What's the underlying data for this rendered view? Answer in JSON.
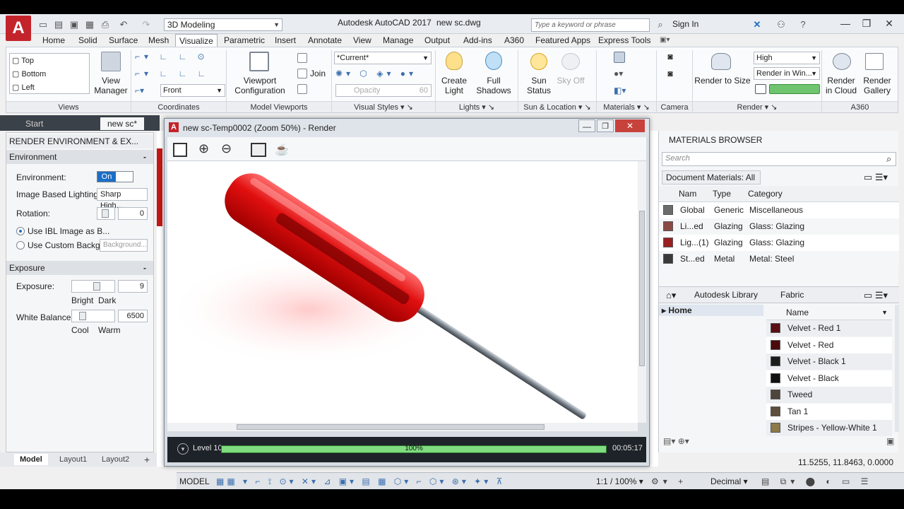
{
  "title": {
    "app_name": "Autodesk AutoCAD 2017",
    "file_name": "new sc.dwg",
    "workspace": "3D Modeling",
    "search_placeholder": "Type a keyword or phrase",
    "sign_in": "Sign In",
    "logo_letter": "A"
  },
  "ribbon_tabs": [
    "Home",
    "Solid",
    "Surface",
    "Mesh",
    "Visualize",
    "Parametric",
    "Insert",
    "Annotate",
    "View",
    "Manage",
    "Output",
    "Add-ins",
    "A360",
    "Featured Apps",
    "Express Tools"
  ],
  "ribbon": {
    "views": {
      "items": [
        "Top",
        "Bottom",
        "Left"
      ],
      "view_manager": "View Manager",
      "title": "Views"
    },
    "coordinates": {
      "front": "Front",
      "title": "Coordinates"
    },
    "model_viewports": {
      "viewport_config": "Viewport Configuration",
      "join": "Join",
      "title": "Model Viewports"
    },
    "visual_styles": {
      "current": "*Current*",
      "opacity": "Opacity",
      "opacity_value": "60",
      "title": "Visual Styles"
    },
    "lights": {
      "create_light": "Create Light",
      "full_shadows": "Full Shadows",
      "title": "Lights"
    },
    "sun_location": {
      "sun_status": "Sun Status",
      "sky_off": "Sky Off",
      "title": "Sun & Location"
    },
    "materials": {
      "title": "Materials"
    },
    "camera": {
      "title": "Camera"
    },
    "render": {
      "quality": "High",
      "render_in": "Render in Win...",
      "render_to_size": "Render to Size",
      "title": "Render"
    },
    "a360": {
      "render_cloud": "Render in Cloud",
      "render_gallery": "Render Gallery",
      "title": "A360"
    }
  },
  "file_tabs": [
    "Start",
    "new sc*"
  ],
  "render_env": {
    "header": "RENDER ENVIRONMENT & EX...",
    "environment_section": "Environment",
    "environment_label": "Environment:",
    "environment_value": "On",
    "ibl_label": "Image Based Lighting:",
    "ibl_value": "Sharp High...",
    "rotation_label": "Rotation:",
    "rotation_value": "0",
    "use_ibl": "Use IBL Image as B...",
    "use_custom": "Use Custom Backg...",
    "background_btn": "Background...",
    "exposure_section": "Exposure",
    "exposure_label": "Exposure:",
    "exposure_value": "9",
    "bright": "Bright",
    "dark": "Dark",
    "white_balance_label": "White Balance:",
    "white_balance_value": "6500",
    "cool": "Cool",
    "warm": "Warm"
  },
  "layout_tabs": [
    "Model",
    "Layout1",
    "Layout2"
  ],
  "render_window": {
    "title": "new sc-Temp0002 (Zoom 50%) - Render",
    "level": "Level 10",
    "progress": 1.0,
    "progress_text": "100%",
    "elapsed": "00:05:17"
  },
  "materials_browser": {
    "title": "MATERIALS BROWSER",
    "search_placeholder": "Search",
    "doc_materials": "Document Materials: All",
    "columns": [
      "Nam",
      "Type",
      "Category"
    ],
    "rows": [
      {
        "name": "Global",
        "type": "Generic",
        "category": "Miscellaneous",
        "swatch": "#6b6b6b"
      },
      {
        "name": "Li...ed",
        "type": "Glazing",
        "category": "Glass: Glazing",
        "swatch": "#8a4a44"
      },
      {
        "name": "Lig...(1)",
        "type": "Glazing",
        "category": "Glass: Glazing",
        "swatch": "#9a1f1f"
      },
      {
        "name": "St...ed",
        "type": "Metal",
        "category": "Metal: Steel",
        "swatch": "#3a3a3a"
      }
    ],
    "breadcrumb": [
      "Autodesk Library",
      "Fabric"
    ],
    "tree_home": "Home",
    "name_column": "Name",
    "library": [
      {
        "name": "Velvet - Red 1",
        "swatch": "#5a0f12"
      },
      {
        "name": "Velvet - Red",
        "swatch": "#4a0a0d"
      },
      {
        "name": "Velvet - Black 1",
        "swatch": "#1c1c1c"
      },
      {
        "name": "Velvet - Black",
        "swatch": "#111111"
      },
      {
        "name": "Tweed",
        "swatch": "#4d463c"
      },
      {
        "name": "Tan 1",
        "swatch": "#5e4e3c"
      },
      {
        "name": "Stripes - Yellow-White 1",
        "swatch": "#8c7a4a"
      }
    ]
  },
  "status": {
    "coords": "11.5255, 11.8463, 0.0000",
    "model": "MODEL",
    "scale": "1:1 / 100%",
    "units": "Decimal"
  },
  "colors": {
    "accent": "#1c6fc6",
    "logo": "#c3242c",
    "progress": "#5fbf5f"
  }
}
